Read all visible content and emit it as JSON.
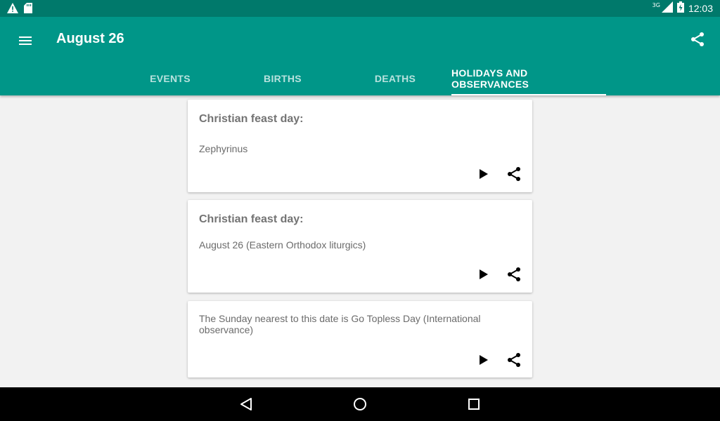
{
  "status_bar": {
    "time": "12:03",
    "network": "3G",
    "icons": [
      "warning-icon",
      "sd-card-icon",
      "signal-icon",
      "battery-icon"
    ]
  },
  "app_bar": {
    "title": "August 26",
    "menu_icon": "hamburger-menu-icon",
    "share_icon": "share-icon",
    "color": "#009688",
    "status_color": "#00796b"
  },
  "tabs": [
    {
      "label": "EVENTS",
      "active": false
    },
    {
      "label": "BIRTHS",
      "active": false
    },
    {
      "label": "DEATHS",
      "active": false
    },
    {
      "label": "HOLIDAYS AND OBSERVANCES",
      "active": true
    }
  ],
  "cards": [
    {
      "title": "Christian feast day:",
      "text": "Zephyrinus"
    },
    {
      "title": "Christian feast day:",
      "text": "August 26 (Eastern Orthodox liturgics)"
    },
    {
      "title": "",
      "text": "The Sunday nearest to this date is Go Topless Day (International observance)"
    }
  ],
  "nav_bar": {
    "back_icon": "back-icon",
    "home_icon": "home-icon",
    "recents_icon": "recents-icon"
  }
}
